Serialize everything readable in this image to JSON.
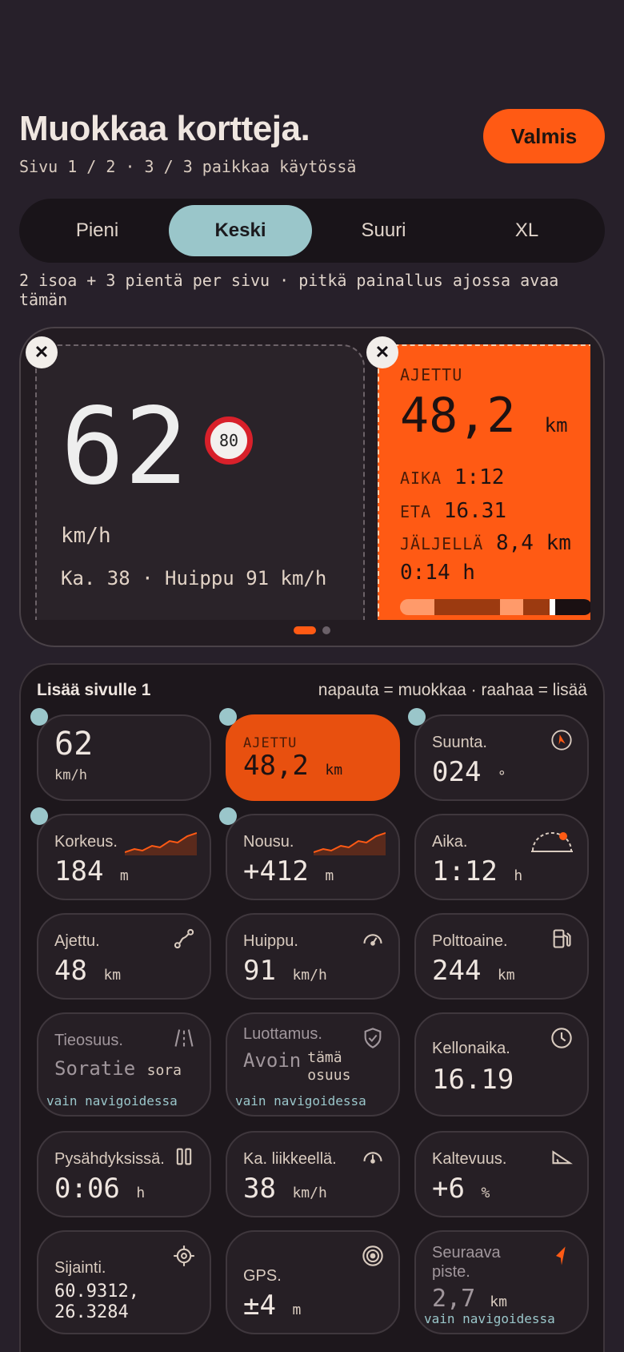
{
  "header": {
    "title": "Muokkaa kortteja.",
    "subtitle": "Sivu 1 / 2 · 3 / 3 paikkaa käytössä",
    "done_label": "Valmis"
  },
  "sizes": {
    "options": [
      "Pieni",
      "Keski",
      "Suuri",
      "XL"
    ],
    "selected": "Keski"
  },
  "size_hint": "2 isoa + 3 pientä per sivu · pitkä painallus ajossa avaa tämän",
  "preview": {
    "speed": {
      "value": "62",
      "limit": "80",
      "unit": "km/h",
      "extra": "Ka. 38 · Huippu 91 km/h"
    },
    "trip": {
      "label": "AJETTU",
      "value": "48,2",
      "unit": "km",
      "time_key": "AIKA",
      "time_val": "1:12",
      "eta_key": "ETA",
      "eta_val": "16.31",
      "remaining_key": "JÄLJELLÄ",
      "remaining_val": "8,4 km 0:14 h"
    },
    "close_symbol": "✕",
    "page_count": 2,
    "current_page": 1
  },
  "add_panel": {
    "title": "Lisää sivulle 1",
    "hint": "napauta = muokkaa · raahaa = lisää",
    "only_nav": "vain navigoidessa",
    "tiles": {
      "speed": {
        "value": "62",
        "unit": "km/h"
      },
      "trip": {
        "label": "AJETTU",
        "value": "48,2",
        "unit": "km"
      },
      "heading": {
        "label": "Suunta.",
        "value": "024",
        "unit": "°"
      },
      "altitude": {
        "label": "Korkeus.",
        "value": "184",
        "unit": "m"
      },
      "climb": {
        "label": "Nousu.",
        "value": "+412",
        "unit": "m"
      },
      "time": {
        "label": "Aika.",
        "value": "1:12",
        "unit": "h"
      },
      "driven": {
        "label": "Ajettu.",
        "value": "48",
        "unit": "km"
      },
      "peak": {
        "label": "Huippu.",
        "value": "91",
        "unit": "km/h"
      },
      "fuel": {
        "label": "Polttoaine.",
        "value": "244",
        "unit": "km"
      },
      "road": {
        "label": "Tieosuus.",
        "value": "Soratie",
        "unit": "sora"
      },
      "trust": {
        "label": "Luottamus.",
        "value": "Avoin",
        "unit": "tämä osuus"
      },
      "clock": {
        "label": "Kellonaika.",
        "value": "16.19"
      },
      "stopped": {
        "label": "Pysähdyksissä.",
        "value": "0:06",
        "unit": "h"
      },
      "avg_moving": {
        "label": "Ka. liikkeellä.",
        "value": "38",
        "unit": "km/h"
      },
      "grade": {
        "label": "Kaltevuus.",
        "value": "+6",
        "unit": "%"
      },
      "location": {
        "label": "Sijainti.",
        "value": "60.9312, 26.3284"
      },
      "gps": {
        "label": "GPS.",
        "value": "±4",
        "unit": "m"
      },
      "next_point": {
        "label": "Seuraava piste.",
        "value": "2,7",
        "unit": "km"
      }
    }
  },
  "colors": {
    "accent": "#ff5a14",
    "selected": "#9ac6ca",
    "background": "#27202a"
  }
}
